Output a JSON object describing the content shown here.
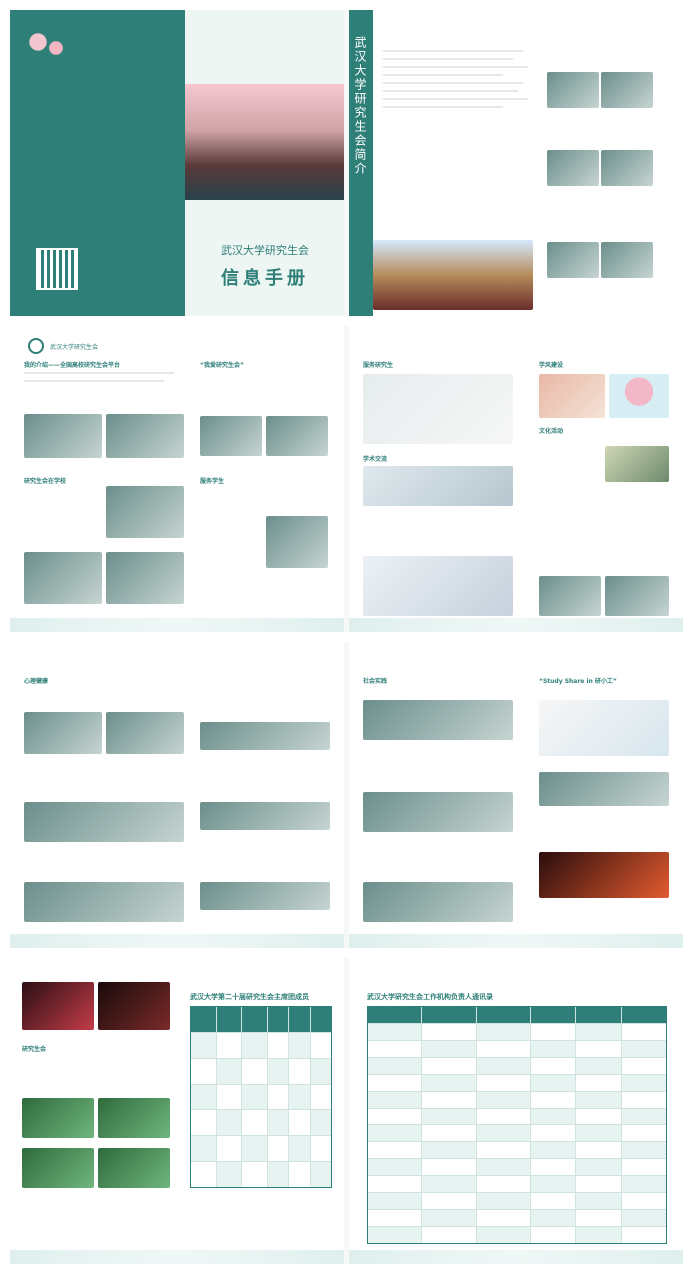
{
  "cover": {
    "school_name_small": "武汉大学研究生会",
    "title": "武汉大学研究生会",
    "subtitle": "信息手册"
  },
  "intro_page": {
    "vertical_title": "武汉大学研究生会简介"
  },
  "section_titles": {
    "s2_left_1": "我的介绍——全国高校研究生会平台",
    "s2_left_2": "研究生会在学校",
    "s2_right_1": "“我爱研究生会”",
    "s2_right_2": "服务学生",
    "s3_left_1": "服务研究生",
    "s3_left_2": "学术交流",
    "s3_right_1": "学风建设",
    "s3_right_2": "文化活动",
    "s4_left_1": "心理健康",
    "s4_right_1": "社会实践",
    "s5_left_1": "研究生会",
    "s5_right_1": "“Study Share in 研小工”"
  },
  "tables": {
    "t1_title": "武汉大学第二十届研究生会主席团成员",
    "t2_title": "武汉大学研究生会工作机构负责人通讯录"
  },
  "colors": {
    "primary": "#2e7f78",
    "accent": "#f3c6d1"
  }
}
